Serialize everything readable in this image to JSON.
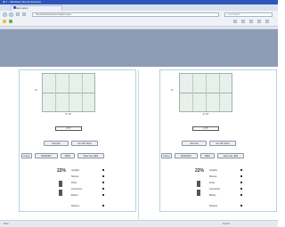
{
  "window": {
    "title": "IE 7 - Windows Internet Explorer"
  },
  "tab": {
    "label": "Rack Layout"
  },
  "address": {
    "value": "http://localhost/rack/configure.aspx"
  },
  "search": {
    "placeholder": "Live Search"
  },
  "left_panel": {
    "width_label": "W: 60\"",
    "height_label": "24\"",
    "value_box": "6' 8\"",
    "buttons": [
      "Add rack",
      "Set 100' Rows"
    ],
    "controls": [
      "Frame",
      "BASE-B16",
      "PREV",
      "Draw only (Dbl)"
    ],
    "percent": "22%",
    "options": [
      "Uprights",
      "Shelves",
      "Posts",
      "Connectors",
      "Bottom",
      "Drawers"
    ]
  },
  "right_panel": {
    "width_label": "W: 60\"",
    "height_label": "24\"",
    "value_box": "6' 8\"",
    "buttons": [
      "Add rack",
      "Set 100' Rows"
    ],
    "controls": [
      "Frame",
      "BASE-B16",
      "PREV",
      "Draw only (Dbl)"
    ],
    "percent": "22%",
    "options": [
      "Uprights",
      "Shelves",
      "Posts",
      "Connectors",
      "Bottom",
      "Drawers"
    ]
  },
  "status": {
    "text": "Done",
    "zone": "Internet"
  }
}
